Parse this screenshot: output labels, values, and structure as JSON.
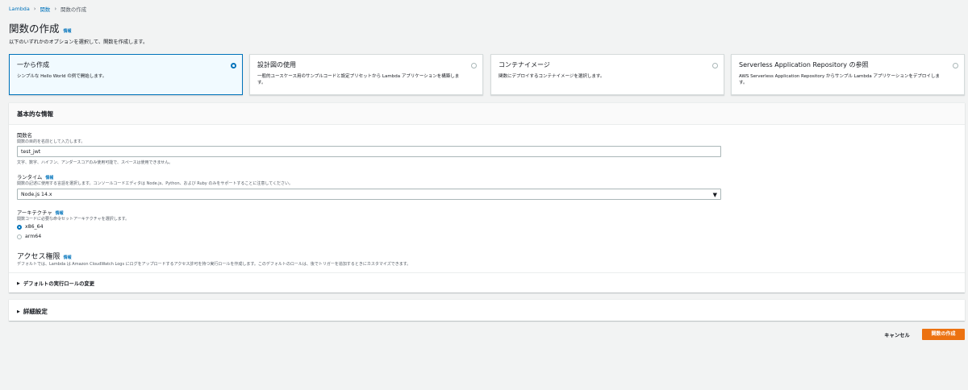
{
  "breadcrumb": {
    "items": [
      "Lambda",
      "関数"
    ],
    "current": "関数の作成"
  },
  "page": {
    "title": "関数の作成",
    "info": "情報",
    "description": "以下のいずれかのオプションを選択して、関数を作成します。"
  },
  "options": [
    {
      "title": "一から作成",
      "desc": "シンプルな Hello World の例で開始します。",
      "selected": true
    },
    {
      "title": "設計図の使用",
      "desc": "一般的ユースケース用のサンプルコードと設定プリセットから Lambda アプリケーションを構築します。",
      "selected": false
    },
    {
      "title": "コンテナイメージ",
      "desc": "関数にデプロイするコンテナイメージを選択します。",
      "selected": false
    },
    {
      "title": "Serverless Application Repository の参照",
      "desc": "AWS Serverless Application Repository からサンプル Lambda アプリケーションをデプロイします。",
      "selected": false
    }
  ],
  "basic": {
    "header": "基本的な情報",
    "function_name": {
      "label": "関数名",
      "desc": "関数の目的を名前として入力します。",
      "value": "test_jwt",
      "hint": "文字、数字、ハイフン、アンダースコアのみ使用可能で、スペースは使用できません。"
    },
    "runtime": {
      "label": "ランタイム",
      "info": "情報",
      "desc": "関数の記述に使用する言語を選択します。コンソールコードエディタは Node.js、Python、および Ruby のみをサポートすることに注意してください。",
      "value": "Node.js 14.x"
    },
    "architecture": {
      "label": "アーキテクチャ",
      "info": "情報",
      "desc": "関数コードに必要な命令セットアーキテクチャを選択します。",
      "options": [
        "x86_64",
        "arm64"
      ],
      "selected": "x86_64"
    },
    "access": {
      "label": "アクセス権限",
      "info": "情報",
      "desc": "デフォルトでは、Lambda は Amazon CloudWatch Logs にログをアップロードするアクセス許可を持つ実行ロールを作成します。このデフォルトのロールは、後でトリガーを追加するときにカスタマイズできます。",
      "expander": "デフォルトの実行ロールの変更"
    }
  },
  "advanced": {
    "label": "詳細設定"
  },
  "actions": {
    "cancel": "キャンセル",
    "create": "関数の作成"
  },
  "colors": {
    "accent": "#0073bb",
    "primary_button": "#ec7211",
    "background": "#f2f3f3"
  }
}
